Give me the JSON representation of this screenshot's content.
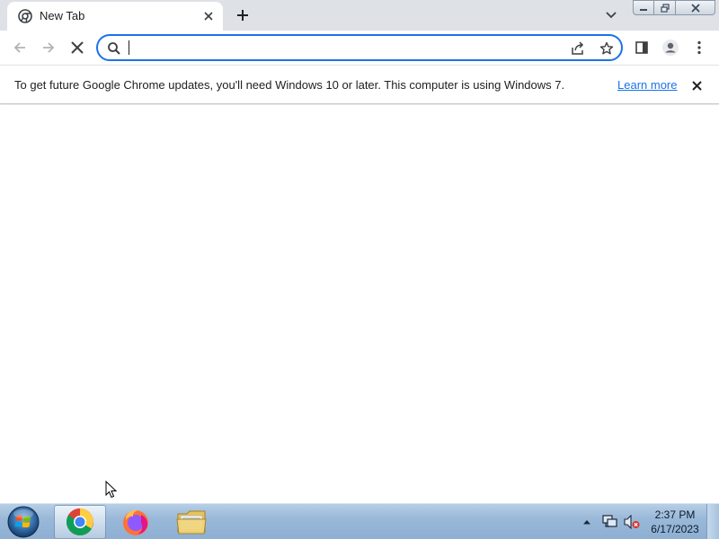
{
  "browser": {
    "tab": {
      "title": "New Tab",
      "favicon": "chrome-newtab-icon"
    },
    "new_tab_icon": "plus-icon",
    "tab_search_icon": "chevron-down-icon"
  },
  "window_controls": {
    "minimize": "minimize-icon",
    "restore": "restore-icon",
    "close": "close-icon"
  },
  "toolbar": {
    "back_icon": "arrow-left-icon",
    "forward_icon": "arrow-right-icon",
    "stop_icon": "stop-loading-icon",
    "omnibox": {
      "value": "",
      "placeholder": "",
      "search_icon": "search-icon",
      "share_icon": "share-icon",
      "bookmark_icon": "star-icon"
    },
    "side_panel_icon": "side-panel-icon",
    "profile_icon": "profile-icon",
    "menu_icon": "kebab-menu-icon"
  },
  "infobar": {
    "message": "To get future Google Chrome updates, you'll need Windows 10 or later. This computer is using Windows 7.",
    "link": "Learn more",
    "close_icon": "close-icon"
  },
  "taskbar": {
    "start_icon": "windows-start-icon",
    "apps": [
      {
        "name": "Google Chrome",
        "icon": "chrome-icon",
        "active": true
      },
      {
        "name": "Firefox",
        "icon": "firefox-icon",
        "active": false
      },
      {
        "name": "Windows Explorer",
        "icon": "folder-icon",
        "active": false
      }
    ],
    "tray": {
      "show_hidden_icon": "caret-up-icon",
      "network_icon": "network-icon",
      "volume_icon": "volume-muted-icon"
    },
    "clock": {
      "time": "2:37 PM",
      "date": "6/17/2023"
    }
  },
  "colors": {
    "accent": "#1a73e8",
    "tabstrip": "#dee1e6",
    "taskbar": "#9ab9d9"
  }
}
